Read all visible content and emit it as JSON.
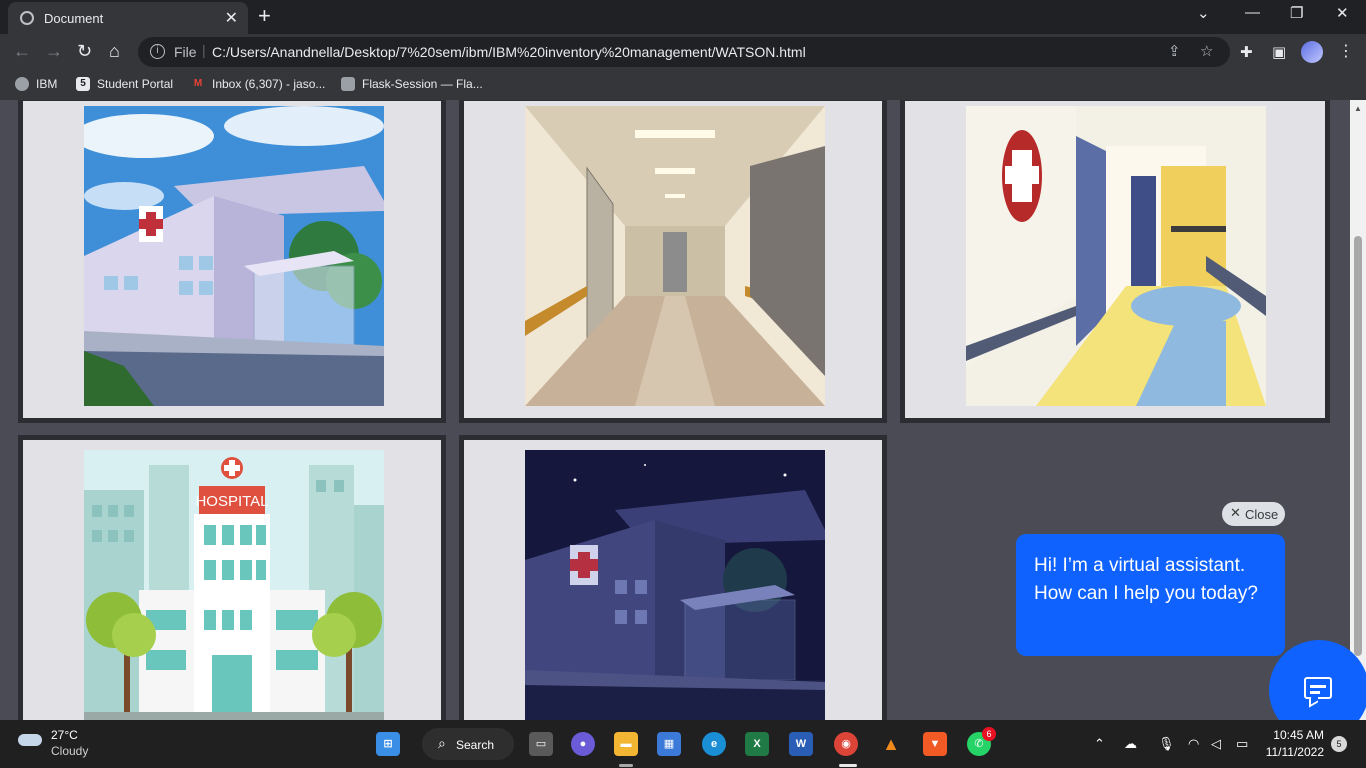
{
  "browser": {
    "tab_title": "Document",
    "url_scheme_label": "File",
    "url": "C:/Users/Anandnella/Desktop/7%20sem/ibm/IBM%20inventory%20management/WATSON.html"
  },
  "bookmarks": [
    {
      "label": "IBM",
      "icon": "globe-icon"
    },
    {
      "label": "Student Portal",
      "icon": "portal-icon"
    },
    {
      "label": "Inbox (6,307) - jaso...",
      "icon": "gmail-icon"
    },
    {
      "label": "Flask-Session — Fla...",
      "icon": "doc-icon"
    }
  ],
  "gallery": {
    "images": [
      {
        "name": "hospital-day-exterior"
      },
      {
        "name": "hospital-corridor"
      },
      {
        "name": "hospital-hallway-cartoon"
      },
      {
        "name": "hospital-building-cartoon",
        "sign_text": "HOSPITAL"
      },
      {
        "name": "hospital-night-exterior"
      }
    ]
  },
  "chat": {
    "close_label": "Close",
    "message": "Hi! I’m a virtual assistant. How can I help you today?",
    "accent": "#0f62fe"
  },
  "taskbar": {
    "temperature": "27°C",
    "condition": "Cloudy",
    "search_label": "Search",
    "whatsapp_badge": "6",
    "time": "10:45 AM",
    "date": "11/11/2022",
    "notifications": "5"
  }
}
